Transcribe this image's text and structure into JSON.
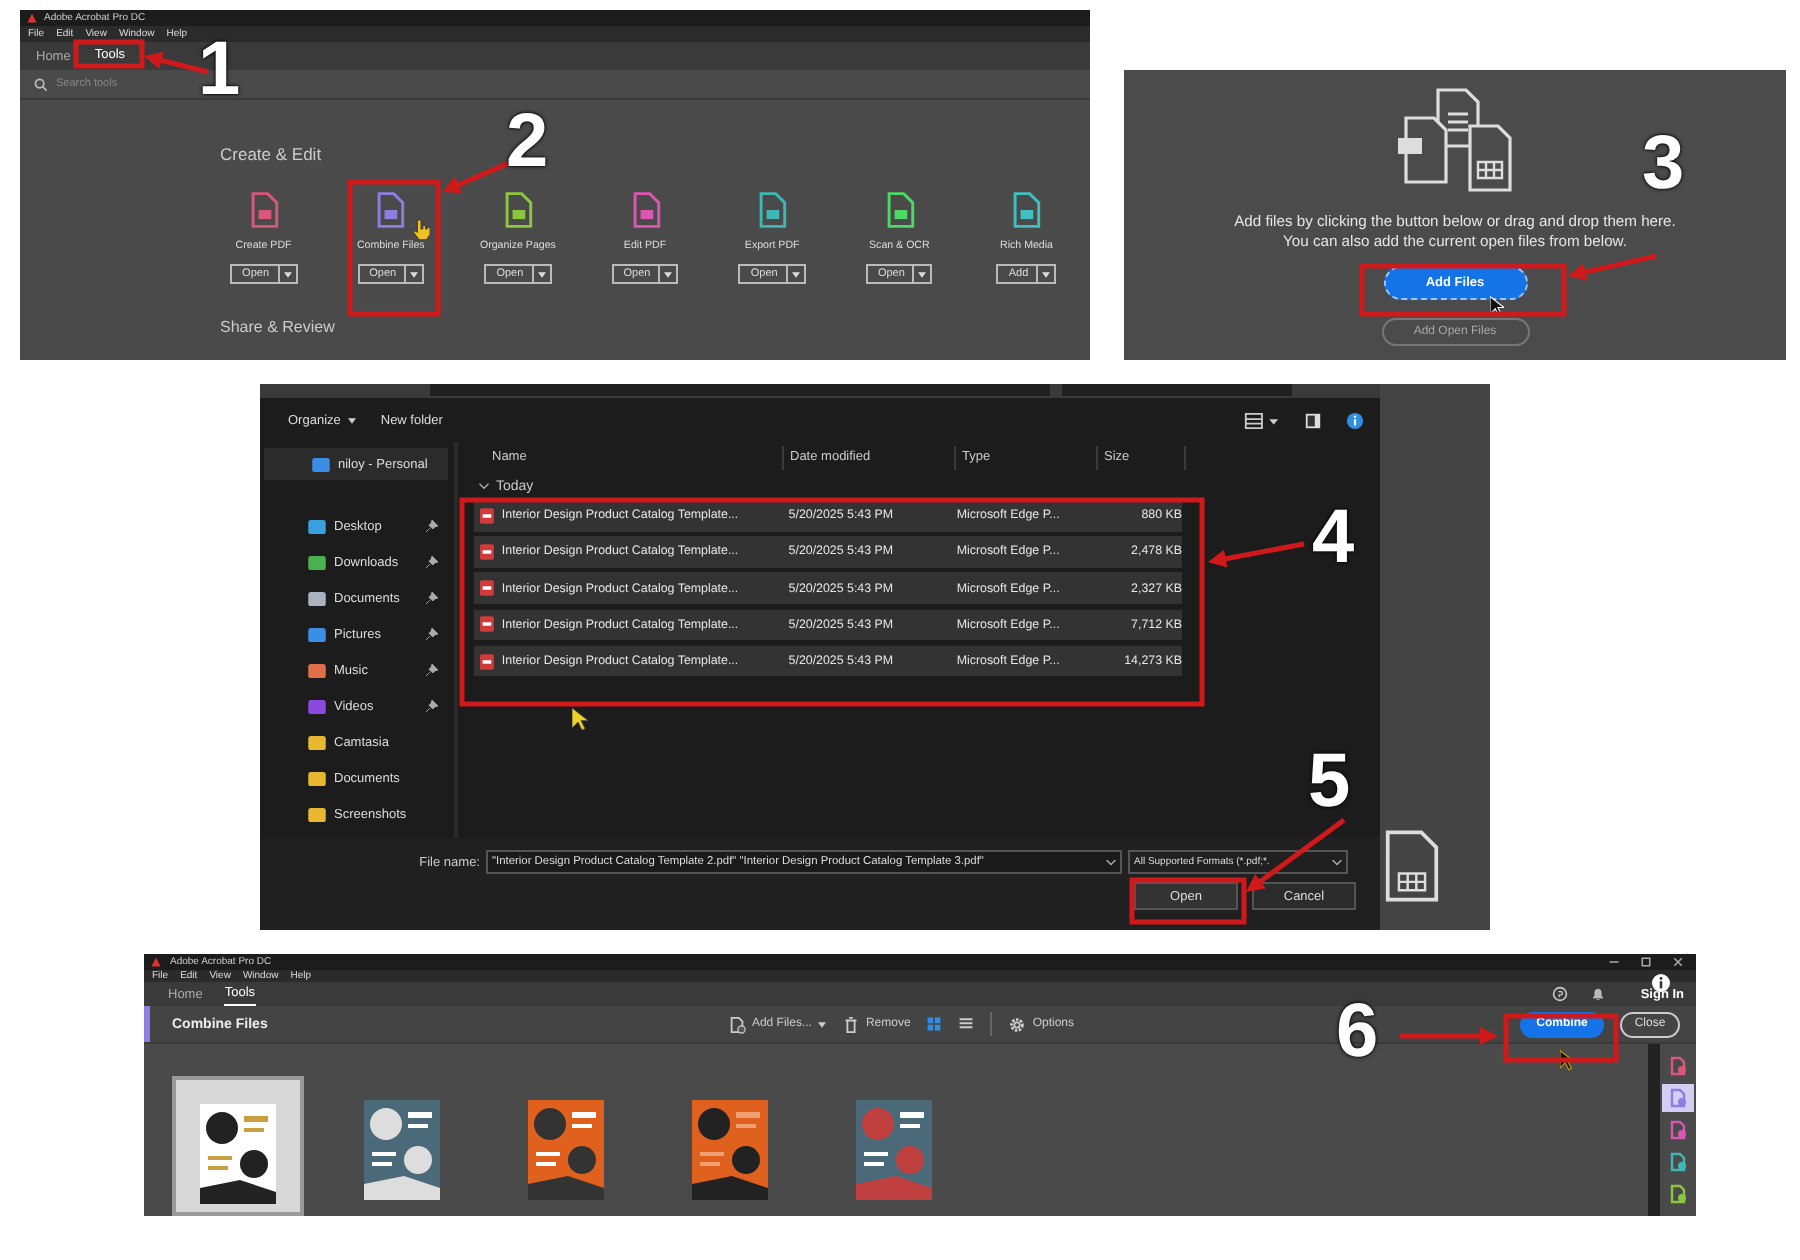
{
  "tools_window": {
    "app_title": "Adobe Acrobat Pro DC",
    "menu": [
      "File",
      "Edit",
      "View",
      "Window",
      "Help"
    ],
    "tabs": [
      {
        "label": "Home",
        "selected": false
      },
      {
        "label": "Tools",
        "selected": true
      }
    ],
    "search": {
      "placeholder": "Search tools"
    },
    "section": "Create & Edit",
    "tools": [
      {
        "label": "Create PDF",
        "button": "Open",
        "color": "#d9577a"
      },
      {
        "label": "Combine Files",
        "button": "Open",
        "color": "#8c7fe0"
      },
      {
        "label": "Organize Pages",
        "button": "Open",
        "color": "#8cc63f"
      },
      {
        "label": "Edit PDF",
        "button": "Open",
        "color": "#d957b0"
      },
      {
        "label": "Export PDF",
        "button": "Open",
        "color": "#3fb7b7"
      },
      {
        "label": "Scan & OCR",
        "button": "Open",
        "color": "#4cd964"
      },
      {
        "label": "Rich Media",
        "button": "Add",
        "color": "#3fc0c0"
      }
    ],
    "next_section": "Share & Review"
  },
  "add_files_panel": {
    "message_lines": [
      "Add files by clicking the button below or drag and drop them here.",
      "You can also add the current open files from below."
    ],
    "primary_button": "Add Files",
    "secondary_button": {
      "label": "Add Open Files",
      "disabled": true
    }
  },
  "open_dialog": {
    "toolbar": [
      "Organize",
      "New folder"
    ],
    "nav": [
      {
        "label": "niloy - Personal",
        "kind": "cloud",
        "pinned": false,
        "selected": true
      },
      {
        "label": "Desktop",
        "kind": "desktop",
        "pinned": true,
        "selected": false
      },
      {
        "label": "Downloads",
        "kind": "downloads",
        "pinned": true,
        "selected": false
      },
      {
        "label": "Documents",
        "kind": "documents",
        "pinned": true,
        "selected": false
      },
      {
        "label": "Pictures",
        "kind": "pictures",
        "pinned": true,
        "selected": false
      },
      {
        "label": "Music",
        "kind": "music",
        "pinned": true,
        "selected": false
      },
      {
        "label": "Videos",
        "kind": "videos",
        "pinned": true,
        "selected": false
      },
      {
        "label": "Camtasia",
        "kind": "folder",
        "pinned": false,
        "selected": false
      },
      {
        "label": "Documents",
        "kind": "folder",
        "pinned": false,
        "selected": false
      },
      {
        "label": "Screenshots",
        "kind": "folder",
        "pinned": false,
        "selected": false
      }
    ],
    "columns": [
      "Name",
      "Date modified",
      "Type",
      "Size"
    ],
    "group": "Today",
    "rows": [
      {
        "name": "Interior Design Product Catalog Template...",
        "date": "5/20/2025 5:43 PM",
        "type": "Microsoft Edge P...",
        "size": "880 KB",
        "selected": true
      },
      {
        "name": "Interior Design Product Catalog Template...",
        "date": "5/20/2025 5:43 PM",
        "type": "Microsoft Edge P...",
        "size": "2,478 KB",
        "selected": true
      },
      {
        "name": "Interior Design Product Catalog Template...",
        "date": "5/20/2025 5:43 PM",
        "type": "Microsoft Edge P...",
        "size": "2,327 KB",
        "selected": true
      },
      {
        "name": "Interior Design Product Catalog Template...",
        "date": "5/20/2025 5:43 PM",
        "type": "Microsoft Edge P...",
        "size": "7,712 KB",
        "selected": true
      },
      {
        "name": "Interior Design Product Catalog Template...",
        "date": "5/20/2025 5:43 PM",
        "type": "Microsoft Edge P...",
        "size": "14,273 KB",
        "selected": true
      }
    ],
    "file_name_label": "File name:",
    "file_name_value": "\"Interior Design Product Catalog Template 2.pdf\" \"Interior Design Product Catalog Template 3.pdf\"",
    "filter": "All Supported Formats (*.pdf;*.",
    "open_button": "Open",
    "cancel_button": "Cancel"
  },
  "combine_window": {
    "app_title": "Adobe Acrobat Pro DC",
    "menu": [
      "File",
      "Edit",
      "View",
      "Window",
      "Help"
    ],
    "tabs": [
      {
        "label": "Home",
        "selected": false
      },
      {
        "label": "Tools",
        "selected": true
      }
    ],
    "sign_in": "Sign In",
    "title": "Combine Files",
    "toolbar": {
      "add_files": "Add Files...",
      "remove": "Remove",
      "options": "Options"
    },
    "combine_button": "Combine",
    "close_button": "Close",
    "thumbnails": [
      {
        "selected": true
      },
      {
        "selected": false
      },
      {
        "selected": false
      },
      {
        "selected": false
      },
      {
        "selected": false
      }
    ],
    "rail_tools": [
      {
        "color": "#d9577a",
        "selected": false
      },
      {
        "color": "#8c7fe0",
        "selected": true
      },
      {
        "color": "#d957b0",
        "selected": false
      },
      {
        "color": "#3fb7b7",
        "selected": false
      },
      {
        "color": "#8cc63f",
        "selected": false
      }
    ]
  },
  "steps": [
    "1",
    "2",
    "3",
    "4",
    "5",
    "6"
  ]
}
